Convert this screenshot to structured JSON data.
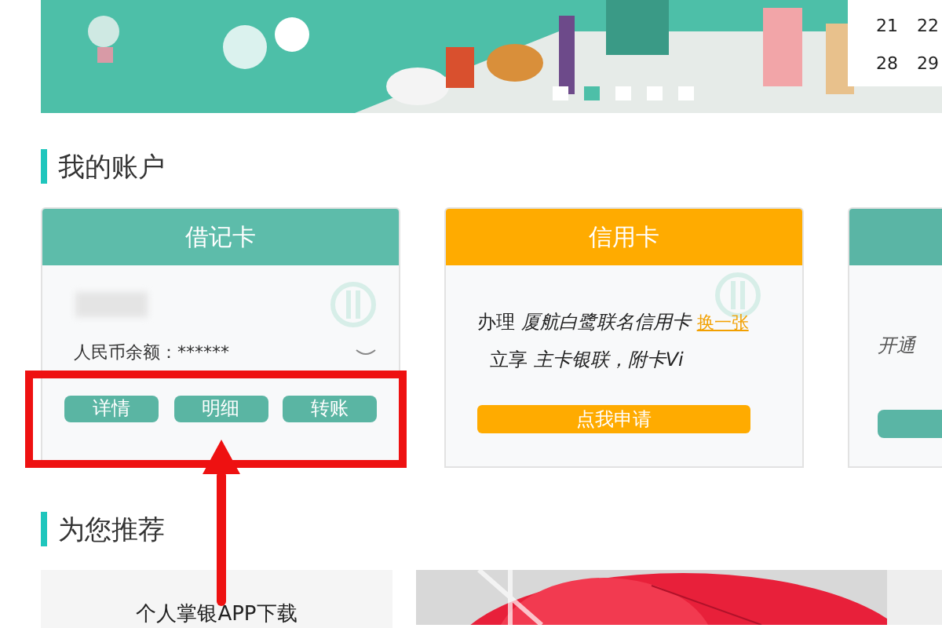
{
  "banner": {
    "dots": [
      {
        "selected": false
      },
      {
        "selected": true
      },
      {
        "selected": false
      },
      {
        "selected": false
      },
      {
        "selected": false
      }
    ],
    "calendar": [
      [
        "21",
        "22"
      ],
      [
        "28",
        "29"
      ]
    ]
  },
  "account_section": {
    "title": "我的账户"
  },
  "cards": [
    {
      "kind": "debit",
      "title": "借记卡",
      "color": "#5dbcaa",
      "balance_label": "人民币余额：******",
      "buttons": [
        "详情",
        "明细",
        "转账"
      ]
    },
    {
      "kind": "credit",
      "title": "信用卡",
      "color": "#ffab00",
      "offer_line": "办理 *厦航白鹭联名信用卡*",
      "swap_link": "换一张",
      "benefit_line": "立享 *主卡银联，附卡Vi*",
      "apply_button": "点我申请"
    },
    {
      "kind": "other",
      "color": "#5ab5a5",
      "text": "开通"
    }
  ],
  "annotation": {
    "highlight": true,
    "arrow": true
  },
  "recommend_section": {
    "title": "为您推荐",
    "app_card": "个人掌银APP下载"
  }
}
